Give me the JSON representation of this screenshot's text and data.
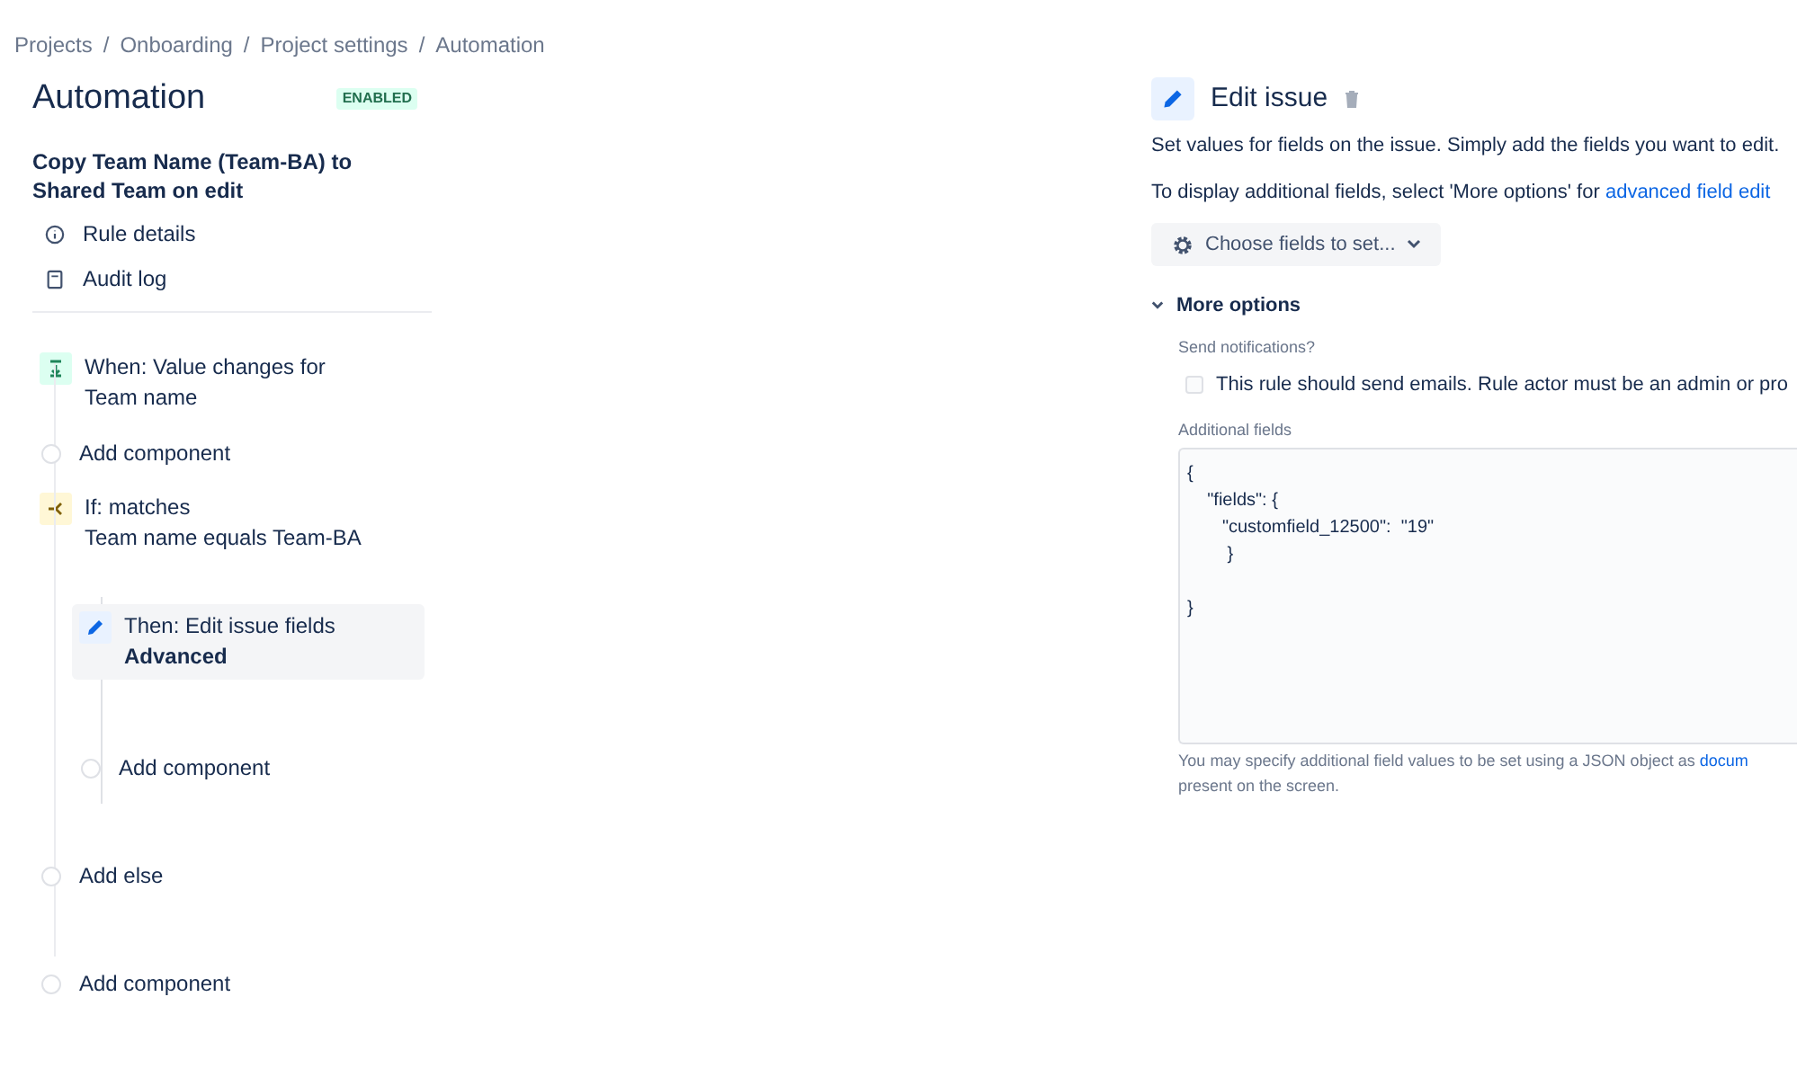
{
  "breadcrumbs": [
    "Projects",
    "Onboarding",
    "Project settings",
    "Automation"
  ],
  "breadcrumb_separator": "/",
  "header": {
    "title": "Automation",
    "status": "ENABLED"
  },
  "rule": {
    "name": "Copy Team Name (Team-BA) to Shared Team on edit",
    "nav": [
      {
        "kind": "info",
        "label": "Rule details"
      },
      {
        "kind": "log",
        "label": "Audit log"
      }
    ]
  },
  "components": [
    {
      "kind": "trigger",
      "title": "When: Value changes for",
      "subtitle": "Team name"
    },
    {
      "kind": "add",
      "label": "Add component"
    },
    {
      "kind": "condition",
      "title": "If: matches",
      "subtitle": "Team name equals Team-BA",
      "children": [
        {
          "kind": "action",
          "title": "Then: Edit issue fields",
          "subtitle": "Advanced",
          "selected": true
        },
        {
          "kind": "add",
          "label": "Add component"
        }
      ]
    },
    {
      "kind": "add",
      "label": "Add else"
    },
    {
      "kind": "add",
      "label": "Add component"
    }
  ],
  "panel": {
    "title": "Edit issue",
    "description": "Set values for fields on the issue. Simply add the fields you want to edit.",
    "hint": "To display additional fields, select 'More options' for ",
    "hint_link": "advanced field edit",
    "choose_button": "Choose fields to set...",
    "more_options": {
      "label": "More options",
      "expanded": true
    },
    "notifications_label": "Send notifications?",
    "notifications": {
      "label": "This rule should send emails. Rule actor must be an admin or pro",
      "checked": false
    },
    "additional_label": "Additional fields",
    "additional_value": "{\n    \"fields\": {\n       \"customfield_12500\":  \"19\"\n        }\n\n}",
    "help": "You may specify additional field values to be set using a JSON object as ",
    "help_link": "docum",
    "help_tail": "present on the screen."
  }
}
